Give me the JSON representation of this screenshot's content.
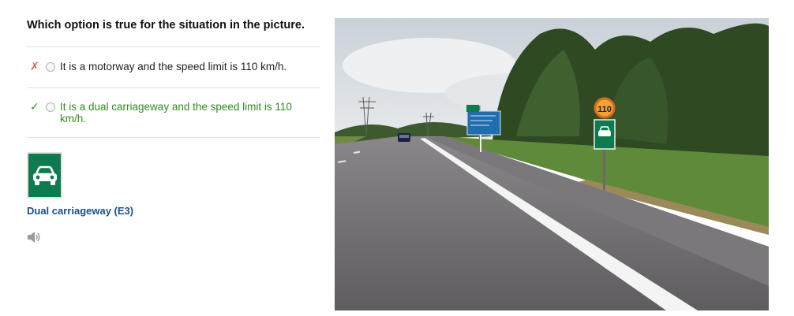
{
  "question": "Which option is true for the situation in the picture.",
  "options": [
    {
      "mark": "✗",
      "status": "wrong",
      "text": "It is a motorway and the speed limit is 110 km/h."
    },
    {
      "mark": "✓",
      "status": "correct",
      "text": "It is a dual carriageway and the speed limit is 110 km/h."
    }
  ],
  "sign": {
    "caption": "Dual carriageway (E3)",
    "icon": "car-icon",
    "color": "#0e7a4f"
  },
  "audio": {
    "icon": "speaker-icon"
  },
  "photo": {
    "speed_sign_value": "110",
    "colors": {
      "sky": "#d6dde3",
      "road": "#6d6a6e",
      "grass": "#5f8a3a",
      "trees": "#2f4a22",
      "sign_blue": "#1f6fb0",
      "sign_green": "#0e7a4f",
      "speed_sign_ring": "#d86a1a",
      "speed_sign_fill": "#f2a23a"
    }
  }
}
